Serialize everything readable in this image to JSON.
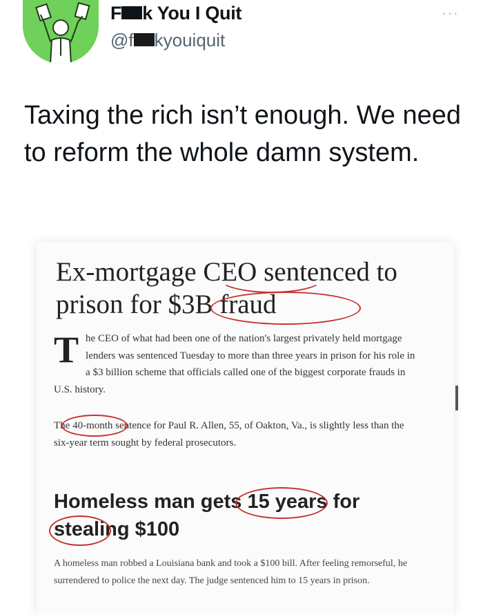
{
  "tweet": {
    "display_name": "k You I Quit",
    "name_prefix": "F",
    "handle_prefix": "@f",
    "handle_suffix": "kyouiquit",
    "more_label": "···",
    "text": "Taxing the rich isn’t enough. We need to reform the whole damn system."
  },
  "image": {
    "article1": {
      "headline": "Ex-mortgage CEO sentenced to prison for $3B fraud",
      "dropcap": "T",
      "para1": "he CEO of what had been one of the nation's largest privately held mortgage lenders was sentenced Tuesday to more than three years in prison for his role in a $3 billion scheme that officials called one of the biggest corporate frauds in U.S. history.",
      "para2": "The 40-month sentence for Paul R. Allen, 55, of Oakton, Va., is slightly less than the six-year term sought by federal prosecutors."
    },
    "article2": {
      "headline": "Homeless man gets 15 years for stealing $100",
      "para": "A homeless man robbed a Louisiana bank and took a $100 bill. After feeling remorseful, he surrendered to police the next day. The judge sentenced him to 15 years in prison."
    }
  },
  "colors": {
    "avatar_bg": "#6fd15a",
    "circle_annotation": "#c8312f",
    "text_primary": "#0f1419",
    "text_secondary": "#536471"
  },
  "icons": [
    "more-icon",
    "avatar-illustration"
  ]
}
